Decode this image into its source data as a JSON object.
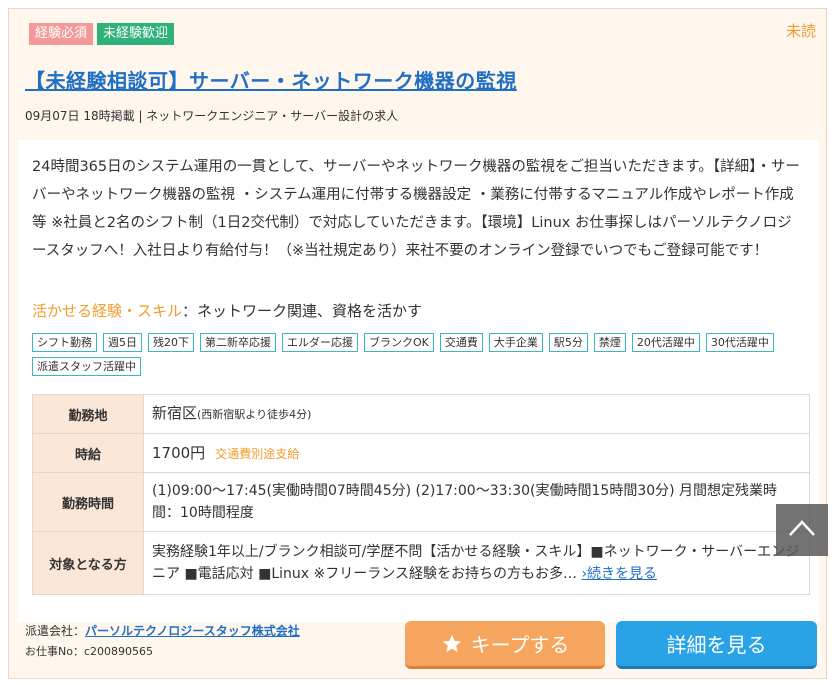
{
  "badges": [
    "経験必須",
    "未経験歓迎"
  ],
  "unread": "未読",
  "title": "【未経験相談可】サーバー・ネットワーク機器の監視",
  "meta": "09月07日 18時掲載 | ネットワークエンジニア・サーバー設計の求人",
  "description": "24時間365日のシステム運用の一貫として、サーバーやネットワーク機器の監視をご担当いただきます。【詳細】・サーバーやネットワーク機器の監視 ・システム運用に付帯する機器設定 ・業務に付帯するマニュアル作成やレポート作成等 ※社員と2名のシフト制（1日2交代制）で対応していただきます。【環境】Linux お仕事探しはパーソルテクノロジースタッフへ！入社日より有給付与！（※当社規定あり）来社不要のオンライン登録でいつでもご登録可能です！",
  "skills": {
    "label": "活かせる経験・スキル",
    "value": "：ネットワーク関連、資格を活かす"
  },
  "tags": [
    "シフト勤務",
    "週5日",
    "残20下",
    "第二新卒応援",
    "エルダー応援",
    "ブランクOK",
    "交通費",
    "大手企業",
    "駅5分",
    "禁煙",
    "20代活躍中",
    "30代活躍中",
    "派遣スタッフ活躍中"
  ],
  "info": {
    "location_label": "勤務地",
    "location_main": "新宿区",
    "location_sub": "(西新宿駅より徒歩4分)",
    "wage_label": "時給",
    "wage_value": "1700円",
    "wage_note": "交通費別途支給",
    "hours_label": "勤務時間",
    "hours_value": "(1)09:00〜17:45(実働時間07時間45分) (2)17:00〜33:30(実働時間15時間30分) 月間想定残業時間：10時間程度",
    "target_label": "対象となる方",
    "target_value": "実務経験1年以上/ブランク相談可/学歴不問【活かせる経験・スキル】■ネットワーク・サーバーエンジニア ■電話応対 ■Linux ※フリーランス経験をお持ちの方もお多…",
    "more_link": "›続きを見る"
  },
  "footer": {
    "company_prefix": "派遣会社：",
    "company_name": "パーソルテクノロジースタッフ株式会社",
    "job_id": "お仕事No：c200890565"
  },
  "buttons": {
    "keep": "キープする",
    "detail": "詳細を見る"
  },
  "colors": {
    "accent_orange": "#f39b2c",
    "link_blue": "#1f6fc5",
    "keep_button": "#f6a55e",
    "detail_button": "#2aa3e6"
  },
  "icons": {
    "keep": "star-icon",
    "scroll_top": "chevron-up-icon"
  }
}
